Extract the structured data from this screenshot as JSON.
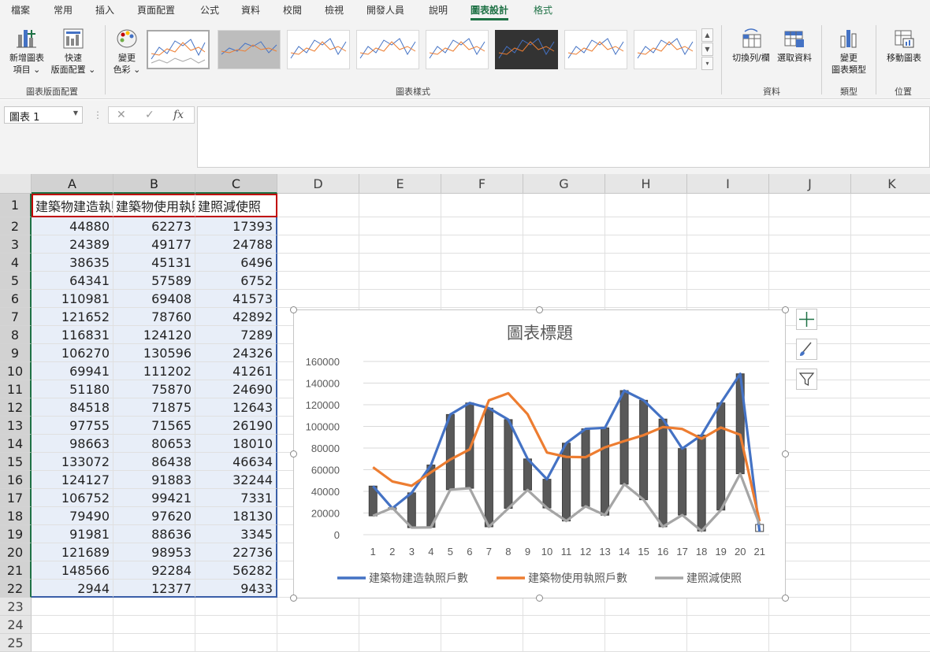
{
  "tabs": [
    {
      "label": "檔案"
    },
    {
      "label": "常用"
    },
    {
      "label": "插入"
    },
    {
      "label": "頁面配置"
    },
    {
      "label": "公式"
    },
    {
      "label": "資料"
    },
    {
      "label": "校閱"
    },
    {
      "label": "檢視"
    },
    {
      "label": "開發人員"
    },
    {
      "label": "說明"
    },
    {
      "label": "圖表設計"
    },
    {
      "label": "格式"
    }
  ],
  "ribbon": {
    "add_element": "新增圖表\n項目 ⌄",
    "quick_layout": "快速\n版面配置 ⌄",
    "change_colors": "變更\n色彩 ⌄",
    "switch_row_col": "切換列/欄",
    "select_data": "選取資料",
    "change_type": "變更\n圖表類型",
    "move_chart": "移動圖表",
    "groups": {
      "layouts": "圖表版面配置",
      "styles": "圖表樣式",
      "data": "資料",
      "type": "類型",
      "location": "位置"
    }
  },
  "formula_bar": {
    "name_box": "圖表 1",
    "fx": "fx"
  },
  "columns": [
    "A",
    "B",
    "C",
    "D",
    "E",
    "F",
    "G",
    "H",
    "I",
    "J",
    "K"
  ],
  "rows": [
    1,
    2,
    3,
    4,
    5,
    6,
    7,
    8,
    9,
    10,
    11,
    12,
    13,
    14,
    15,
    16,
    17,
    18,
    19,
    20,
    21,
    22,
    23,
    24,
    25
  ],
  "headers": [
    "建築物建造執照戶數",
    "建築物使用執照戶數",
    "建照減使照"
  ],
  "table": [
    [
      44880,
      62273,
      17393
    ],
    [
      24389,
      49177,
      24788
    ],
    [
      38635,
      45131,
      6496
    ],
    [
      64341,
      57589,
      6752
    ],
    [
      110981,
      69408,
      41573
    ],
    [
      121652,
      78760,
      42892
    ],
    [
      116831,
      124120,
      7289
    ],
    [
      106270,
      130596,
      24326
    ],
    [
      69941,
      111202,
      41261
    ],
    [
      51180,
      75870,
      24690
    ],
    [
      84518,
      71875,
      12643
    ],
    [
      97755,
      71565,
      26190
    ],
    [
      98663,
      80653,
      18010
    ],
    [
      133072,
      86438,
      46634
    ],
    [
      124127,
      91883,
      32244
    ],
    [
      106752,
      99421,
      7331
    ],
    [
      79490,
      97620,
      18130
    ],
    [
      91981,
      88636,
      3345
    ],
    [
      121689,
      98953,
      22736
    ],
    [
      148566,
      92284,
      56282
    ],
    [
      2944,
      12377,
      9433
    ]
  ],
  "chart_data": {
    "type": "line",
    "title": "圖表標題",
    "x": [
      1,
      2,
      3,
      4,
      5,
      6,
      7,
      8,
      9,
      10,
      11,
      12,
      13,
      14,
      15,
      16,
      17,
      18,
      19,
      20,
      21
    ],
    "ylim": [
      0,
      160000
    ],
    "yticks": [
      0,
      20000,
      40000,
      60000,
      80000,
      100000,
      120000,
      140000,
      160000
    ],
    "grid": true,
    "legend": "bottom",
    "updown_bars": true,
    "series": [
      {
        "name": "建築物建造執照戶數",
        "color": "#4472c4",
        "values": [
          44880,
          24389,
          38635,
          64341,
          110981,
          121652,
          116831,
          106270,
          69941,
          51180,
          84518,
          97755,
          98663,
          133072,
          124127,
          106752,
          79490,
          91981,
          121689,
          148566,
          2944
        ]
      },
      {
        "name": "建築物使用執照戶數",
        "color": "#ed7d31",
        "values": [
          62273,
          49177,
          45131,
          57589,
          69408,
          78760,
          124120,
          130596,
          111202,
          75870,
          71875,
          71565,
          80653,
          86438,
          91883,
          99421,
          97620,
          88636,
          98953,
          92284,
          12377
        ]
      },
      {
        "name": "建照減使照",
        "color": "#a5a5a5",
        "values": [
          17393,
          24788,
          6496,
          6752,
          41573,
          42892,
          7289,
          24326,
          41261,
          24690,
          12643,
          26190,
          18010,
          46634,
          32244,
          7331,
          18130,
          3345,
          22736,
          56282,
          9433
        ]
      }
    ]
  }
}
